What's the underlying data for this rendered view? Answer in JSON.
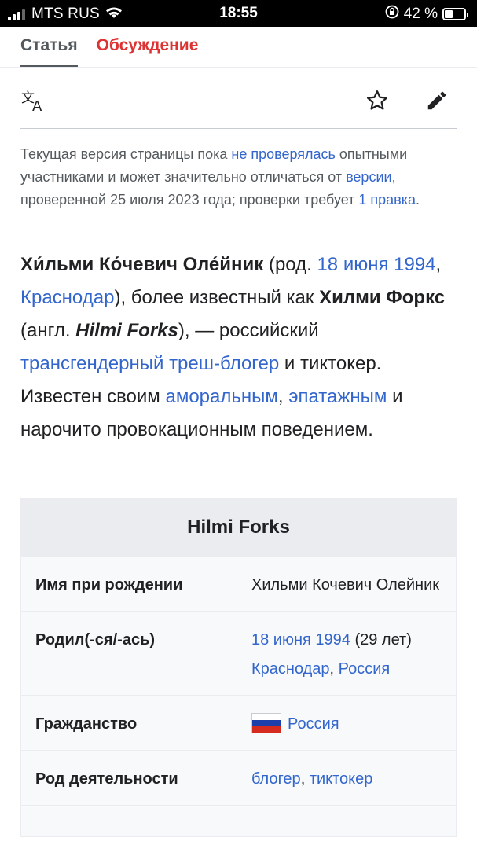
{
  "status_bar": {
    "carrier": "MTS RUS",
    "time": "18:55",
    "battery_percent": "42 %",
    "battery_level": 0.42,
    "icons": [
      "signal-icon",
      "wifi-icon",
      "rotation-lock-icon",
      "battery-icon"
    ]
  },
  "tabs": [
    {
      "label": "Статья",
      "active": true
    },
    {
      "label": "Обсуждение",
      "active": false
    }
  ],
  "toolbar": {
    "icons": [
      "language-icon",
      "star-icon",
      "edit-pencil-icon"
    ]
  },
  "notice": {
    "text1": "Текущая версия страницы пока ",
    "link1": "не проверялась",
    "text2": " опытными участниками и может значительно отличаться от ",
    "link2": "версии",
    "text3": ", проверенной 25 июля 2023 года; проверки требует ",
    "link3": "1 правка",
    "text4": "."
  },
  "lead": {
    "name_bold": "Хи́льми Ко́чевич Оле́йник",
    "t1": " (род. ",
    "birth_date_link": "18 июня 1994",
    "t2": ", ",
    "birth_place_link": "Краснодар",
    "t3": "), более известный как ",
    "alias_bold": "Хилми Форкс",
    "t4": " (англ. ",
    "alias_en": "Hilmi Forks",
    "t5": "), — российский ",
    "link_trans": "трансгендерный",
    "t6": " ",
    "link_trash": "треш-блогер",
    "t7": " и тиктокер. Известен своим ",
    "link_amoral": "аморальным",
    "t8": ", ",
    "link_epat": "эпатажным",
    "t9": " и нарочито провокационным поведением."
  },
  "infobox": {
    "title": "Hilmi Forks",
    "rows": [
      {
        "key": "Имя при рождении",
        "value": "Хильми Кочевич Олейник"
      },
      {
        "key": "Родил(-ся/-ась)",
        "date_link": "18 июня 1994",
        "age": " (29 лет)",
        "city_link": "Краснодар",
        "sep": ", ",
        "country_link": "Россия"
      },
      {
        "key": "Гражданство",
        "value_link": "Россия"
      },
      {
        "key": "Род деятельности",
        "link1": "блогер",
        "sep": ", ",
        "link2": "тиктокер"
      }
    ]
  },
  "colors": {
    "link": "#3366cc",
    "talk_tab": "#dd3333",
    "infobox_header": "#eaecf0",
    "infobox_bg": "#f8f9fa"
  }
}
